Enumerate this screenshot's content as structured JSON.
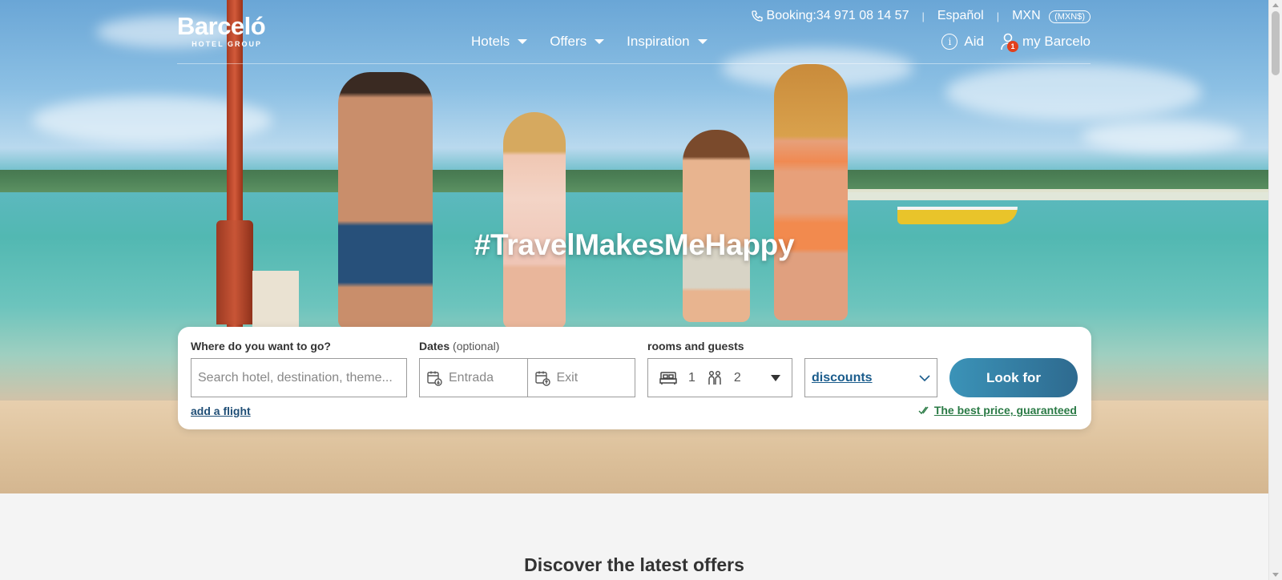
{
  "header": {
    "logo": {
      "main": "Barceló",
      "sub": "HOTEL GROUP"
    },
    "topbar": {
      "booking": "Booking:34 971 08 14 57",
      "language": "Español",
      "currency": "MXN",
      "currency_badge": "(MXN$)"
    },
    "nav": [
      {
        "label": "Hotels"
      },
      {
        "label": "Offers"
      },
      {
        "label": "Inspiration"
      }
    ],
    "aid_label": "Aid",
    "account_label": "my Barcelo",
    "notification_count": "1"
  },
  "hero": {
    "tagline": "#TravelMakesMeHappy"
  },
  "search": {
    "destination_label": "Where do you want to go?",
    "destination_placeholder": "Search hotel, destination, theme...",
    "dates_label": "Dates",
    "dates_optional": "(optional)",
    "checkin_placeholder": "Entrada",
    "checkout_placeholder": "Exit",
    "rooms_label": "rooms and guests",
    "rooms_count": "1",
    "guests_count": "2",
    "discounts_label": "discounts",
    "submit_label": "Look for",
    "add_flight": "add a flight",
    "best_price": "The best price, guaranteed"
  },
  "main": {
    "section_title": "Discover the latest offers"
  },
  "colors": {
    "accent": "#2e6a8f",
    "link": "#1f4e76",
    "guarantee": "#2a7a45",
    "badge": "#e2401c"
  }
}
